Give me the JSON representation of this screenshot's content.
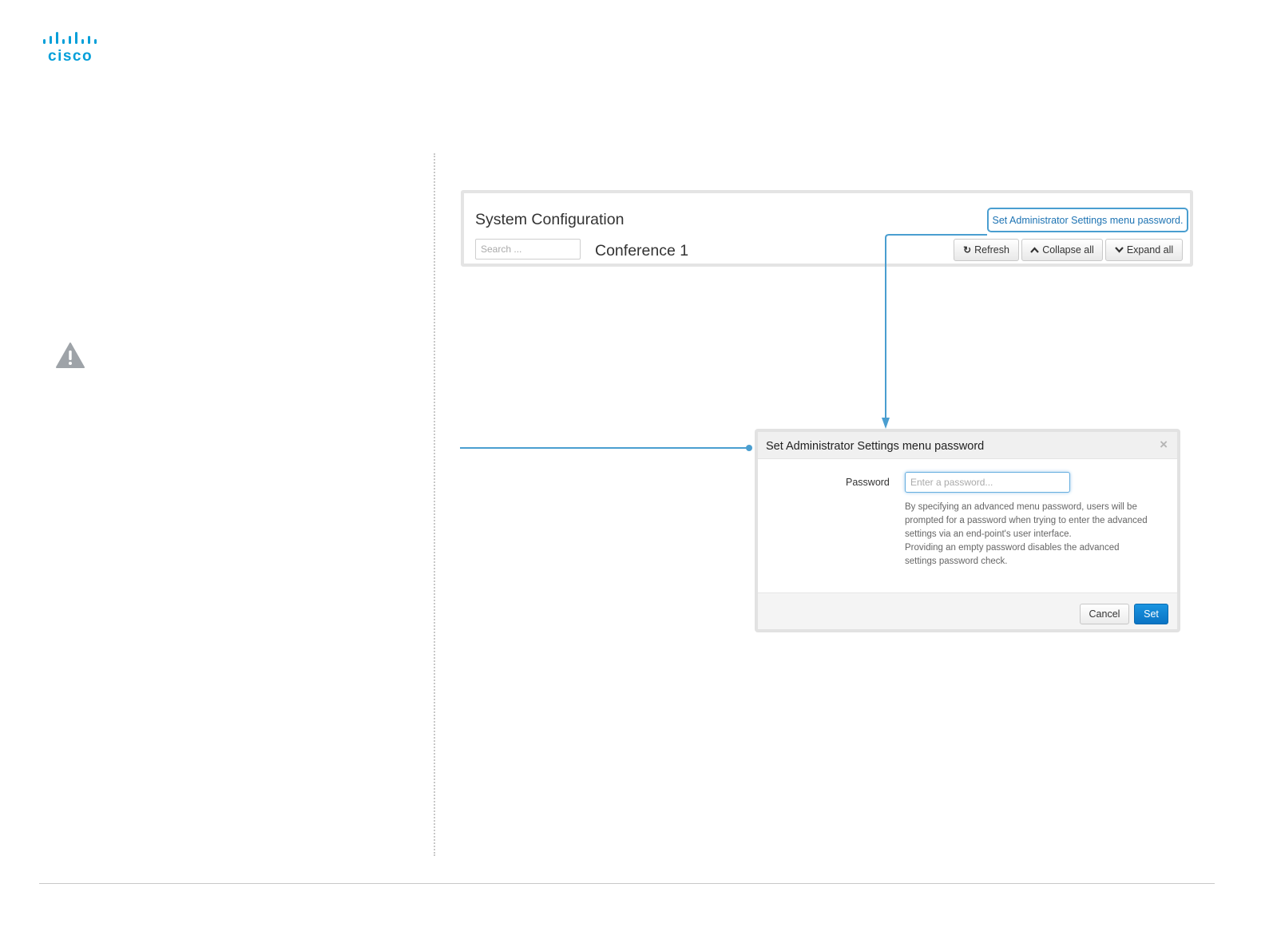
{
  "logo": {
    "text": "cisco",
    "icon": "cisco-bars-logo"
  },
  "icons": {
    "warning": "warning-triangle-icon",
    "refresh": "refresh-icon",
    "collapse": "chevron-up-icon",
    "expand": "chevron-down-icon",
    "close": "close-icon"
  },
  "system_config": {
    "title": "System Configuration",
    "search_placeholder": "Search ...",
    "section_title": "Conference 1",
    "admin_link": "Set Administrator Settings menu password.",
    "refresh_label": "Refresh",
    "collapse_label": "Collapse all",
    "expand_label": "Expand all"
  },
  "dialog": {
    "title": "Set Administrator Settings menu password",
    "close_symbol": "×",
    "password_label": "Password",
    "password_placeholder": "Enter a password...",
    "help_lines": [
      "By specifying an advanced menu password, users will be",
      "prompted for a password when trying to enter the advanced",
      "settings via an end-point's user interface.",
      "Providing an empty password disables the advanced",
      "settings password check."
    ],
    "cancel_label": "Cancel",
    "set_label": "Set"
  },
  "colors": {
    "accent": "#049fd9",
    "callout_line": "#4a9ed0",
    "primary_button": "#0a74c4"
  }
}
